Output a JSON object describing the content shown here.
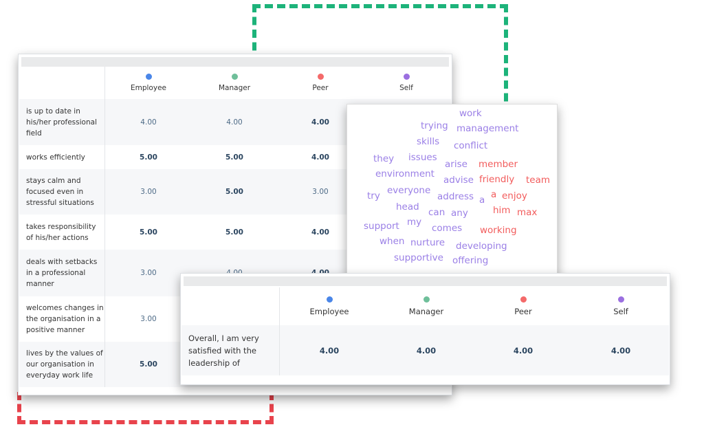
{
  "colors": {
    "employee": "#4a86e8",
    "manager": "#6fbf9a",
    "peer": "#f46a6a",
    "self": "#9b6fe0",
    "cloud_purple": "#9a7fe6",
    "cloud_red": "#f25c5c"
  },
  "columns": [
    "Employee",
    "Manager",
    "Peer",
    "Self"
  ],
  "main_table": {
    "rows": [
      {
        "label": "is up to date in his/her professional field",
        "values": [
          "4.00",
          "4.00",
          "4.00"
        ],
        "bold": [
          false,
          false,
          true
        ]
      },
      {
        "label": "works efficiently",
        "values": [
          "5.00",
          "5.00",
          "4.00"
        ],
        "bold": [
          true,
          true,
          true
        ]
      },
      {
        "label": "stays calm and focused even in stressful situations",
        "values": [
          "3.00",
          "5.00",
          "3.00"
        ],
        "bold": [
          false,
          true,
          false
        ]
      },
      {
        "label": "takes responsibility of his/her actions",
        "values": [
          "5.00",
          "5.00",
          "4.00"
        ],
        "bold": [
          true,
          true,
          true
        ]
      },
      {
        "label": "deals with setbacks in a professional manner",
        "values": [
          "3.00",
          "4.00",
          "4.00"
        ],
        "bold": [
          false,
          false,
          true
        ]
      },
      {
        "label": "welcomes changes in the organisation in a positive manner",
        "values": [
          "3.00"
        ],
        "bold": [
          false
        ]
      },
      {
        "label": "lives by the values of our organisation in everyday work life",
        "values": [
          "5.00"
        ],
        "bold": [
          true
        ]
      }
    ]
  },
  "summary_table": {
    "row": {
      "label": "Overall, I am very satisfied with the leadership of",
      "values": [
        "4.00",
        "4.00",
        "4.00",
        "4.00"
      ]
    }
  },
  "word_cloud": [
    {
      "text": "work",
      "color": "purple"
    },
    {
      "text": "trying",
      "color": "purple"
    },
    {
      "text": "management",
      "color": "purple"
    },
    {
      "text": "skills",
      "color": "purple"
    },
    {
      "text": "conflict",
      "color": "purple"
    },
    {
      "text": "they",
      "color": "purple"
    },
    {
      "text": "issues",
      "color": "purple"
    },
    {
      "text": "arise",
      "color": "purple"
    },
    {
      "text": "member",
      "color": "red"
    },
    {
      "text": "environment",
      "color": "purple"
    },
    {
      "text": "advise",
      "color": "purple"
    },
    {
      "text": "friendly",
      "color": "red"
    },
    {
      "text": "team",
      "color": "red"
    },
    {
      "text": "try",
      "color": "purple"
    },
    {
      "text": "everyone",
      "color": "purple"
    },
    {
      "text": "address",
      "color": "purple"
    },
    {
      "text": "a",
      "color": "purple"
    },
    {
      "text": "a",
      "color": "red"
    },
    {
      "text": "enjoy",
      "color": "red"
    },
    {
      "text": "head",
      "color": "purple"
    },
    {
      "text": "can",
      "color": "purple"
    },
    {
      "text": "any",
      "color": "purple"
    },
    {
      "text": "him",
      "color": "red"
    },
    {
      "text": "max",
      "color": "red"
    },
    {
      "text": "support",
      "color": "purple"
    },
    {
      "text": "my",
      "color": "purple"
    },
    {
      "text": "comes",
      "color": "purple"
    },
    {
      "text": "working",
      "color": "red"
    },
    {
      "text": "when",
      "color": "purple"
    },
    {
      "text": "nurture",
      "color": "purple"
    },
    {
      "text": "developing",
      "color": "purple"
    },
    {
      "text": "supportive",
      "color": "purple"
    },
    {
      "text": "offering",
      "color": "purple"
    }
  ]
}
